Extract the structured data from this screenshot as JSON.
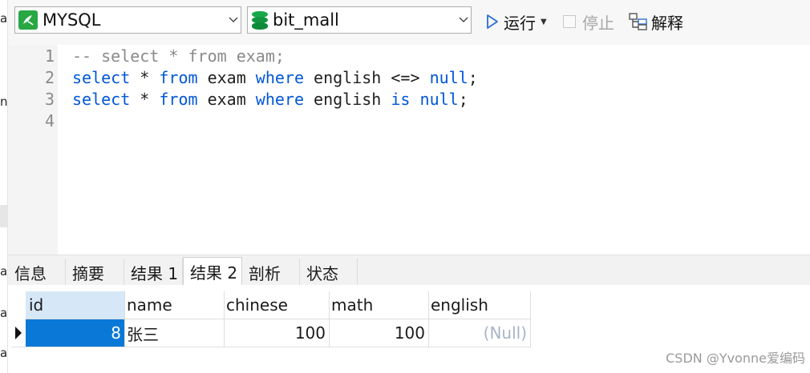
{
  "left_strip": {
    "glyphs": [
      "a",
      "n",
      "a",
      "a",
      "a"
    ]
  },
  "toolbar": {
    "connection": "MYSQL",
    "database": "bit_mall",
    "run_label": "运行",
    "stop_label": "停止",
    "explain_label": "解释"
  },
  "editor": {
    "lines": [
      {
        "no": "1",
        "tokens": [
          {
            "t": "-- select * from exam;",
            "c": "cm"
          }
        ]
      },
      {
        "no": "2",
        "tokens": [
          {
            "t": "select",
            "c": "kw"
          },
          {
            "t": " * ",
            "c": "tx"
          },
          {
            "t": "from",
            "c": "kw"
          },
          {
            "t": " exam ",
            "c": "tx"
          },
          {
            "t": "where",
            "c": "kw"
          },
          {
            "t": " english <=> ",
            "c": "tx"
          },
          {
            "t": "null",
            "c": "kw"
          },
          {
            "t": ";",
            "c": "tx"
          }
        ]
      },
      {
        "no": "3",
        "tokens": [
          {
            "t": "select",
            "c": "kw"
          },
          {
            "t": " * ",
            "c": "tx"
          },
          {
            "t": "from",
            "c": "kw"
          },
          {
            "t": " exam ",
            "c": "tx"
          },
          {
            "t": "where",
            "c": "kw"
          },
          {
            "t": " english ",
            "c": "tx"
          },
          {
            "t": "is",
            "c": "kw"
          },
          {
            "t": " ",
            "c": "tx"
          },
          {
            "t": "null",
            "c": "kw"
          },
          {
            "t": ";",
            "c": "tx"
          }
        ]
      },
      {
        "no": "4",
        "tokens": []
      }
    ]
  },
  "tabs": [
    "信息",
    "摘要",
    "结果 1",
    "结果 2",
    "剖析",
    "状态"
  ],
  "active_tab": "结果 2",
  "grid": {
    "columns": [
      "id",
      "name",
      "chinese",
      "math",
      "english"
    ],
    "rows": [
      [
        "8",
        "张三",
        "100",
        "100",
        "(Null)"
      ]
    ]
  },
  "watermark": "CSDN @Yvonne爱编码",
  "colors": {
    "keyword": "#0057d8",
    "comment": "#8a8a8a",
    "selected_cell": "#0a78d7",
    "header_selected": "#d6e8f8",
    "null_text": "#a8b3c8"
  }
}
